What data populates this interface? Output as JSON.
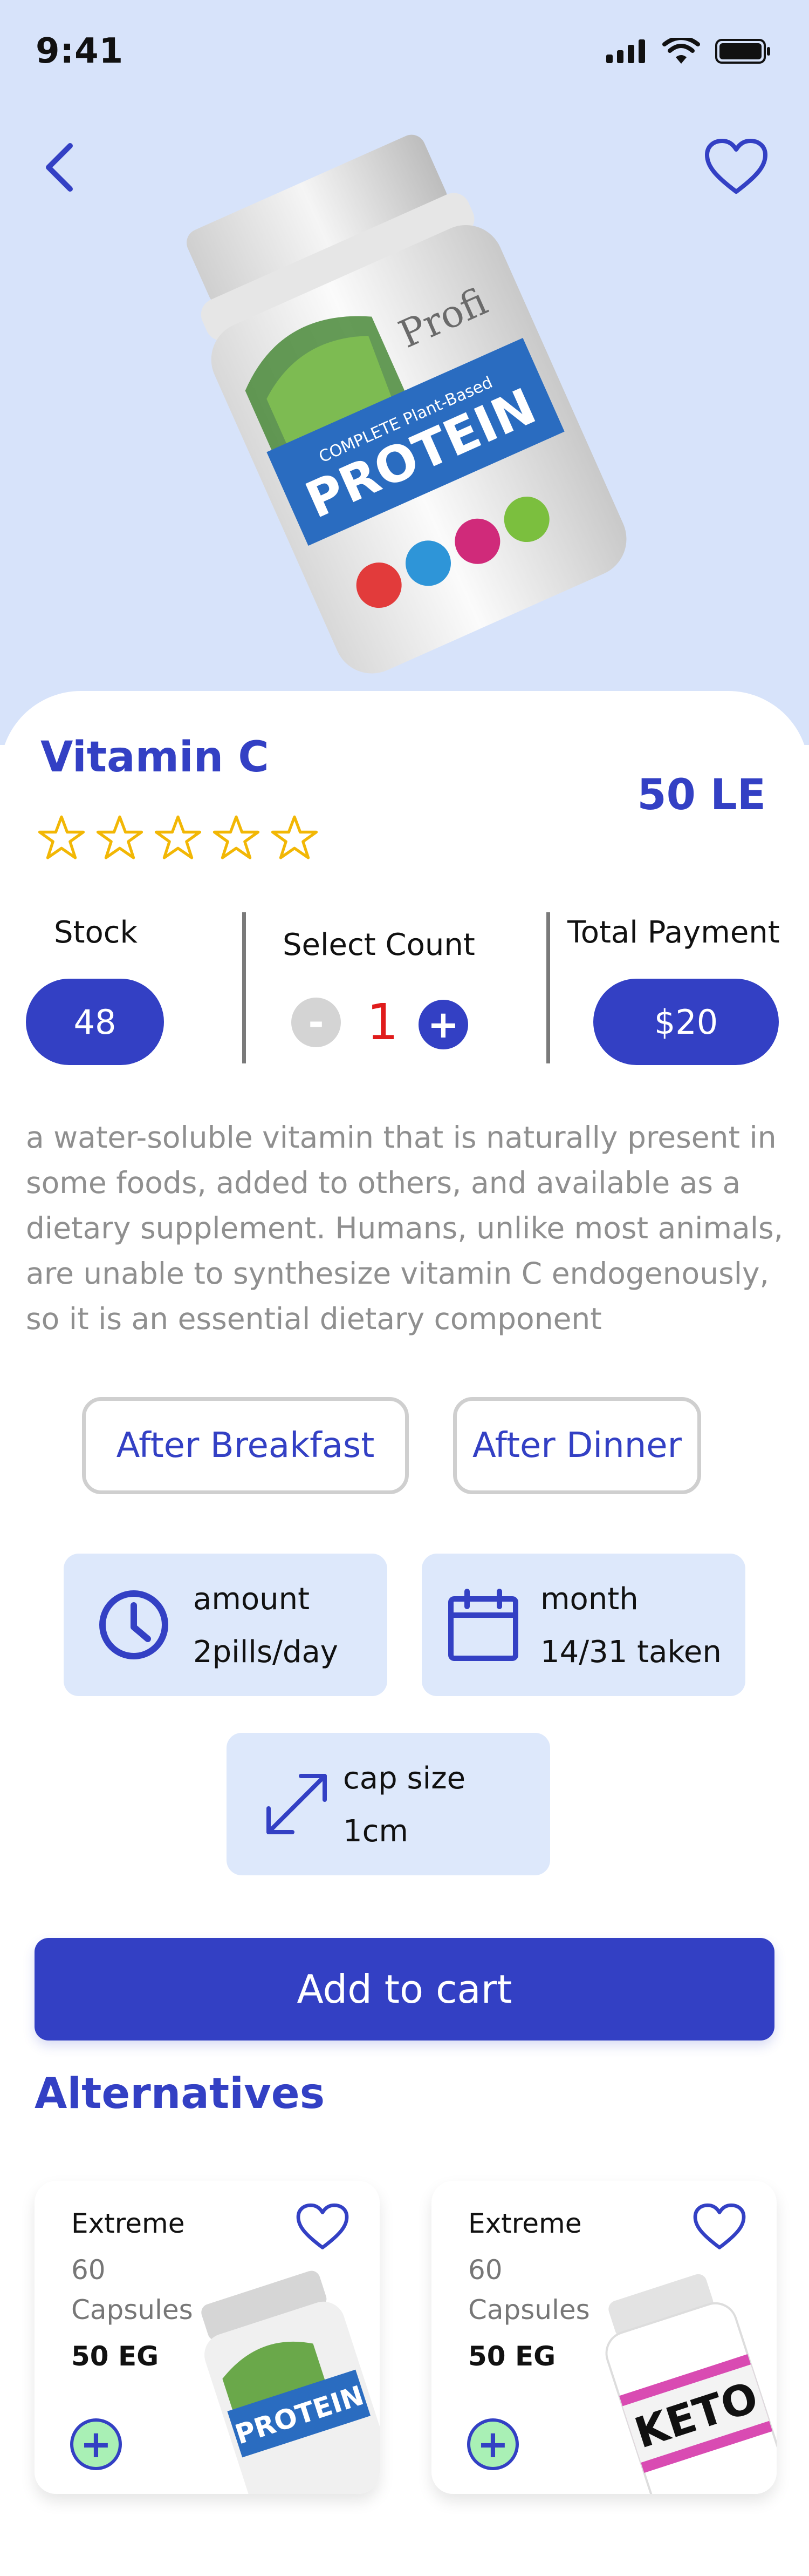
{
  "status": {
    "time": "9:41"
  },
  "product": {
    "title": "Vitamin C",
    "price": "50 LE",
    "jar_brand": "Profi",
    "jar_label": "PROTEIN"
  },
  "stock": {
    "label": "Stock",
    "value": "48"
  },
  "count": {
    "label": "Select Count",
    "minus": "-",
    "value": "1",
    "plus": "+"
  },
  "payment": {
    "label": "Total Payment",
    "value": "$20"
  },
  "description": "a water-soluble vitamin that is naturally present in some foods, added to others, and available as a dietary supplement. Humans, unlike most animals, are unable to synthesize vitamin C endogenously, so it is an essential dietary component",
  "timing": {
    "after_breakfast": "After Breakfast",
    "after_dinner": "After Dinner"
  },
  "details": {
    "amount_label": "amount",
    "amount_value": "2pills/day",
    "month_label": "month",
    "month_value": "14/31 taken",
    "cap_label": "cap size",
    "cap_value": "1cm"
  },
  "cta": "Add to cart",
  "alternatives": {
    "title": "Alternatives",
    "items": [
      {
        "name": "Extreme",
        "qty_line1": "60",
        "qty_line2": "Capsules",
        "price": "50 EG",
        "image_text": "PROTEIN"
      },
      {
        "name": "Extreme",
        "qty_line1": "60",
        "qty_line2": "Capsules",
        "price": "50 EG",
        "image_text": "KETO"
      }
    ]
  },
  "colors": {
    "accent": "#3340c4",
    "hero_bg": "#d7e3fa",
    "card_bg": "#dde8fb",
    "count_red": "#e01b1b",
    "add_green": "#a9f0b5"
  }
}
